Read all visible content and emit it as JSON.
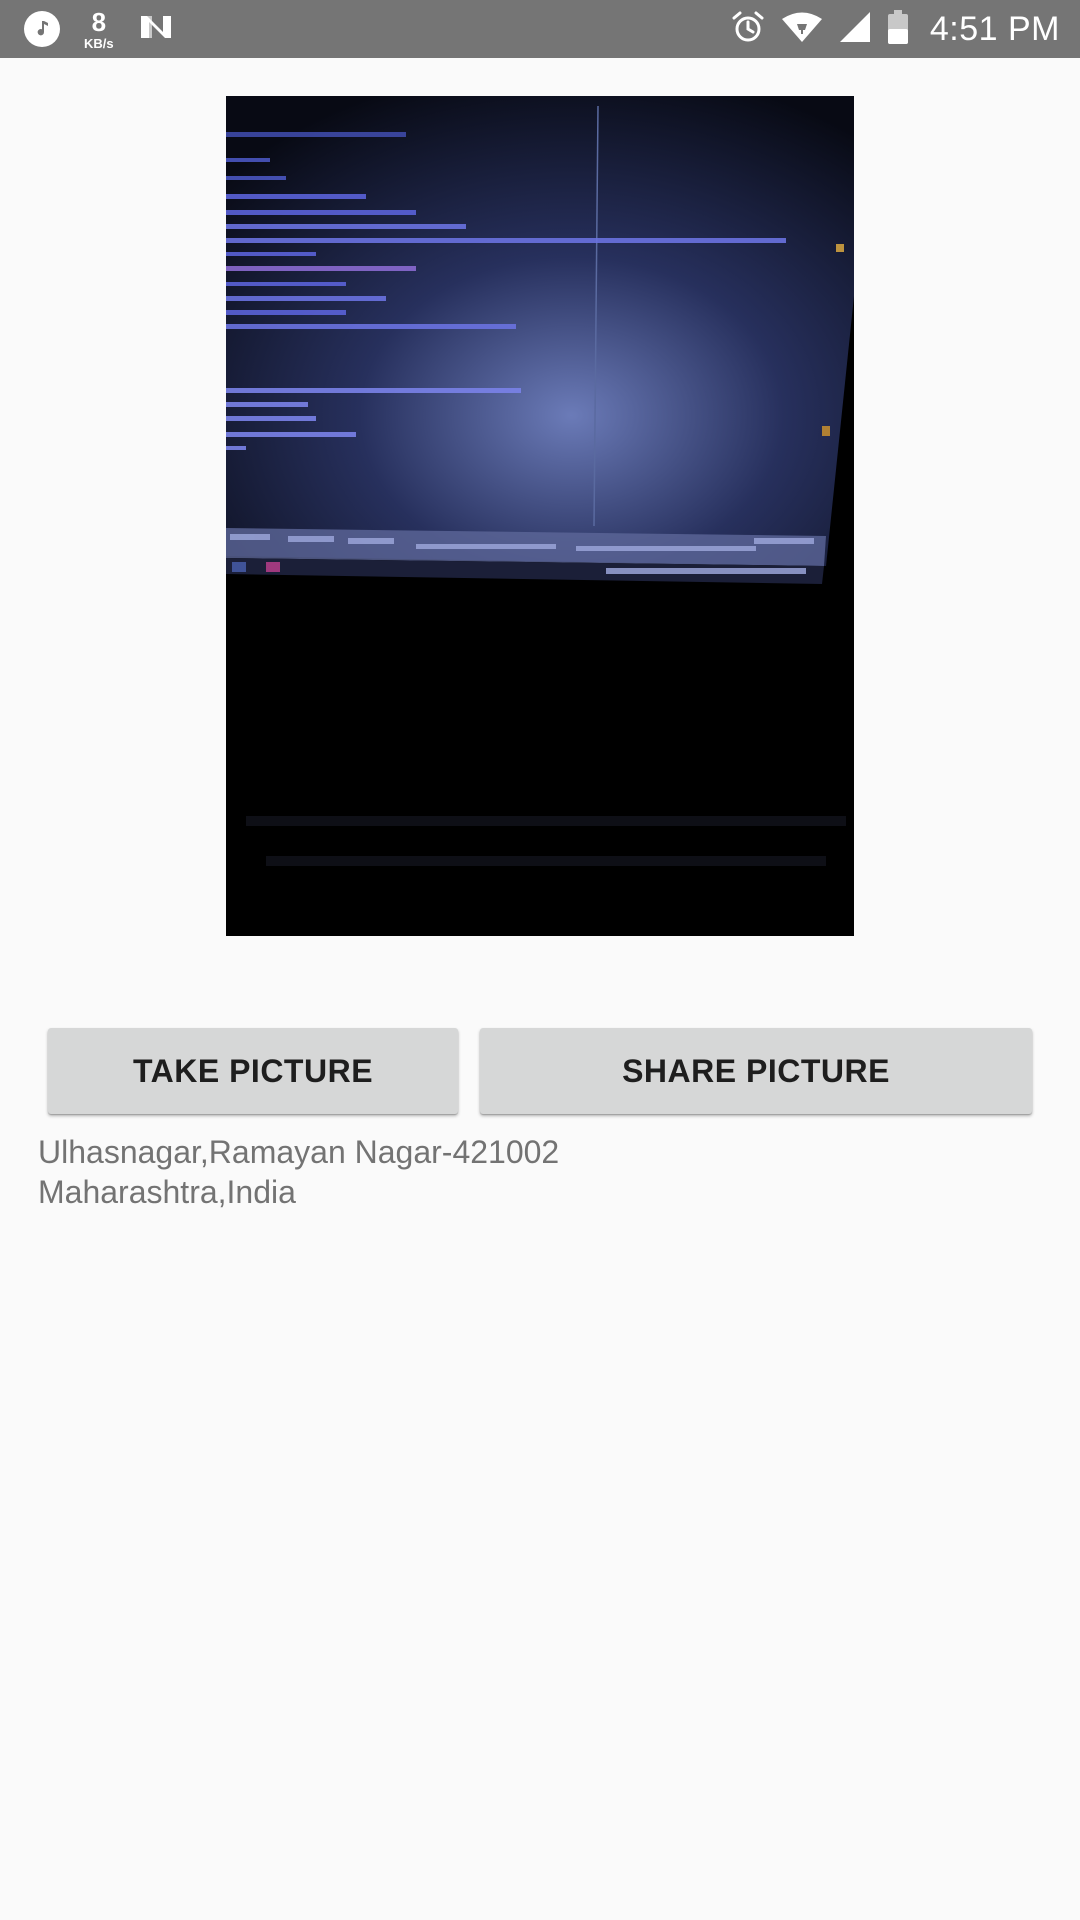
{
  "status_bar": {
    "net_speed_value": "8",
    "net_speed_unit": "KB/s",
    "time": "4:51 PM",
    "left_icons": [
      "music-icon",
      "n-icon"
    ],
    "right_icons": [
      "alarm-icon",
      "wifi-icon",
      "signal-icon",
      "battery-icon"
    ]
  },
  "main": {
    "photo_alt": "Captured photo",
    "take_picture_label": "TAKE PICTURE",
    "share_picture_label": "SHARE PICTURE",
    "address_line1": "Ulhasnagar,Ramayan Nagar-421002",
    "address_line2": "Maharashtra,India"
  },
  "colors": {
    "status_bar": "#757575",
    "background": "#fafafa",
    "button": "#d6d7d7",
    "button_text": "#1e1e1e",
    "address_text": "#737373"
  }
}
